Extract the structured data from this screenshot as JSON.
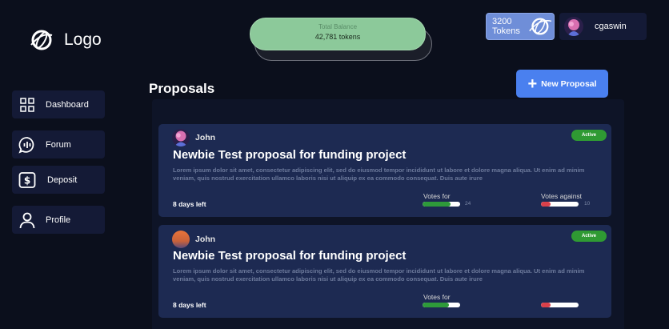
{
  "logo": {
    "text": "Logo",
    "icon": "globe-logo-icon"
  },
  "balance": {
    "label": "Total Balance",
    "value": "42,781 tokens"
  },
  "tokens": {
    "amount": "3200",
    "unit": "Tokens"
  },
  "user": {
    "name": "cgaswin"
  },
  "sidebar": {
    "items": [
      {
        "label": "Dashboard",
        "icon": "dashboard-grid-icon"
      },
      {
        "label": "Forum",
        "icon": "forum-chat-icon"
      },
      {
        "label": "Deposit",
        "icon": "dollar-icon"
      },
      {
        "label": "Profile",
        "icon": "user-icon"
      }
    ]
  },
  "main": {
    "title": "Proposals",
    "new_button_label": "New Proposal"
  },
  "proposals": [
    {
      "author": "John",
      "status": "Active",
      "title": "Newbie Test proposal for funding project",
      "description": "Lorem ipsum dolor sit amet, consectetur adipiscing elit, sed do eiusmod tempor incididunt ut labore et dolore magna aliqua. Ut enim ad minim veniam, quis nostrud exercitation ullamco laboris nisi ut aliquip ex ea commodo consequat. Duis aute irure",
      "deadline": "8 days left",
      "votes_for_label": "Votes for",
      "votes_against_label": "Votes against",
      "votes_for": "24",
      "votes_against": "10",
      "for_fraction": 0.75,
      "against_fraction": 0.25
    },
    {
      "author": "John",
      "status": "Active",
      "title": "Newbie Test proposal for funding project",
      "description": "Lorem ipsum dolor sit amet, consectetur adipiscing elit, sed do eiusmod tempor incididunt ut labore et dolore magna aliqua. Ut enim ad minim veniam, quis nostrud exercitation ullamco laboris nisi ut aliquip ex ea commodo consequat. Duis aute irure",
      "deadline": "8 days left",
      "votes_for_label": "Votes for",
      "for_fraction": 0.7,
      "against_fraction": 0.25
    }
  ],
  "colors": {
    "background": "#0b0f1c",
    "card": "#1d2a52",
    "accent": "#4a80ef",
    "balance": "#8cc99a",
    "active": "#2f9a33",
    "vote_for": "#2e9a3a",
    "vote_against": "#d9404a"
  }
}
